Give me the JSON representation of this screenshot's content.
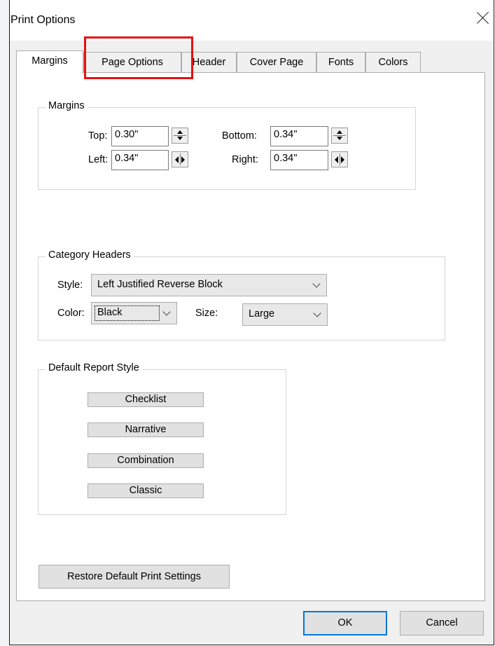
{
  "window": {
    "title": "Print Options"
  },
  "tabs": [
    {
      "label": "Margins",
      "active": true
    },
    {
      "label": "Page Options",
      "active": false
    },
    {
      "label": "Header",
      "active": false
    },
    {
      "label": "Cover Page",
      "active": false
    },
    {
      "label": "Fonts",
      "active": false
    },
    {
      "label": "Colors",
      "active": false
    }
  ],
  "margins": {
    "group_label": "Margins",
    "top": {
      "label": "Top:",
      "value": "0.30\""
    },
    "bottom": {
      "label": "Bottom:",
      "value": "0.34\""
    },
    "left": {
      "label": "Left:",
      "value": "0.34\""
    },
    "right": {
      "label": "Right:",
      "value": "0.34\""
    }
  },
  "category_headers": {
    "group_label": "Category Headers",
    "style_label": "Style:",
    "style_value": "Left Justified Reverse Block",
    "color_label": "Color:",
    "color_value": "Black",
    "size_label": "Size:",
    "size_value": "Large"
  },
  "default_report_style": {
    "group_label": "Default Report Style",
    "buttons": [
      "Checklist",
      "Narrative",
      "Combination",
      "Classic"
    ]
  },
  "restore_button": "Restore Default Print Settings",
  "ok_button": "OK",
  "cancel_button": "Cancel",
  "colors": {
    "highlight": "#e81010",
    "default_button_border": "#0078d7"
  }
}
